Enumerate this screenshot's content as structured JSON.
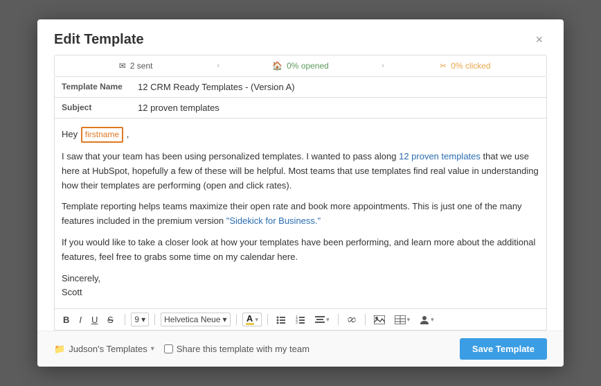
{
  "modal": {
    "title": "Edit Template",
    "close_label": "×"
  },
  "stats": [
    {
      "icon": "✉",
      "value": "2 sent",
      "color": "default"
    },
    {
      "icon": "🏠",
      "value": "0% opened",
      "color": "green"
    },
    {
      "icon": "✂",
      "value": "0% clicked",
      "color": "orange"
    }
  ],
  "fields": {
    "template_name_label": "Template Name",
    "template_name_value": "12 CRM Ready Templates - (Version A)",
    "subject_label": "Subject",
    "subject_value": "12 proven templates"
  },
  "email": {
    "greeting_hey": "Hey",
    "firstname_tag": "firstname",
    "greeting_comma": ",",
    "para1": "I saw that your team has been using personalized templates. I wanted to pass along",
    "para1_link_text": "12 proven templates",
    "para1_rest": "that we use here at HubSpot, hopefully a few of these will be helpful. Most teams that use templates find real value in understanding how their templates are performing (open and click rates).",
    "para2_a": "Template reporting helps teams maximize their open rate and book more appointments. This is just one of the many features included in the premium version ",
    "para2_link": "\"Sidekick for Business.\"",
    "para3": "If you would like to take a closer look at how your templates have been performing, and learn more about the additional features, feel free to grabs some time on my calendar here.",
    "sign_sincerely": "Sincerely,",
    "sign_name": "Scott"
  },
  "toolbar": {
    "bold": "B",
    "italic": "I",
    "underline": "U",
    "strikethrough": "S̶",
    "font_size": "9",
    "font_size_arrow": "▾",
    "font_family": "Helvetica Neue",
    "font_family_arrow": "▾",
    "color_a": "A",
    "color_arrow": "▾",
    "unordered_list": "☰",
    "ordered_list": "☰",
    "align": "☰",
    "align_arrow": "▾",
    "link": "🔗",
    "image": "🖼",
    "table": "⊞",
    "table_arrow": "▾",
    "person": "👤",
    "person_arrow": "▾"
  },
  "footer": {
    "folder_icon": "📁",
    "folder_name": "Judson's Templates",
    "folder_arrow": "▾",
    "share_label": "Share this template with my team",
    "save_label": "Save Template"
  }
}
